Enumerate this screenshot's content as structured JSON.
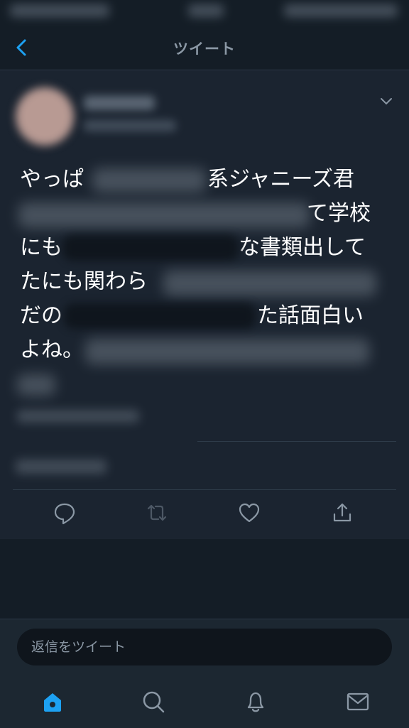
{
  "header": {
    "title": "ツイート"
  },
  "tweet": {
    "lines": [
      {
        "left": "やっぱ",
        "right": "系ジャニーズ君"
      },
      {
        "left": "",
        "right": "て学校"
      },
      {
        "left": "にも",
        "right": "な書類出して"
      },
      {
        "left": "たにも関わら",
        "right": ""
      },
      {
        "left": "だの",
        "right": "た話面白い"
      },
      {
        "left": "よね。",
        "right": ""
      }
    ]
  },
  "reply": {
    "placeholder": "返信をツイート"
  },
  "actions": [
    "reply-icon",
    "retweet-icon",
    "like-icon",
    "share-icon"
  ],
  "tabs": [
    "home-icon",
    "search-icon",
    "notifications-icon",
    "messages-icon"
  ],
  "colors": {
    "background": "#141d26",
    "accent": "#1da1f2",
    "muted": "#8b98a5"
  }
}
